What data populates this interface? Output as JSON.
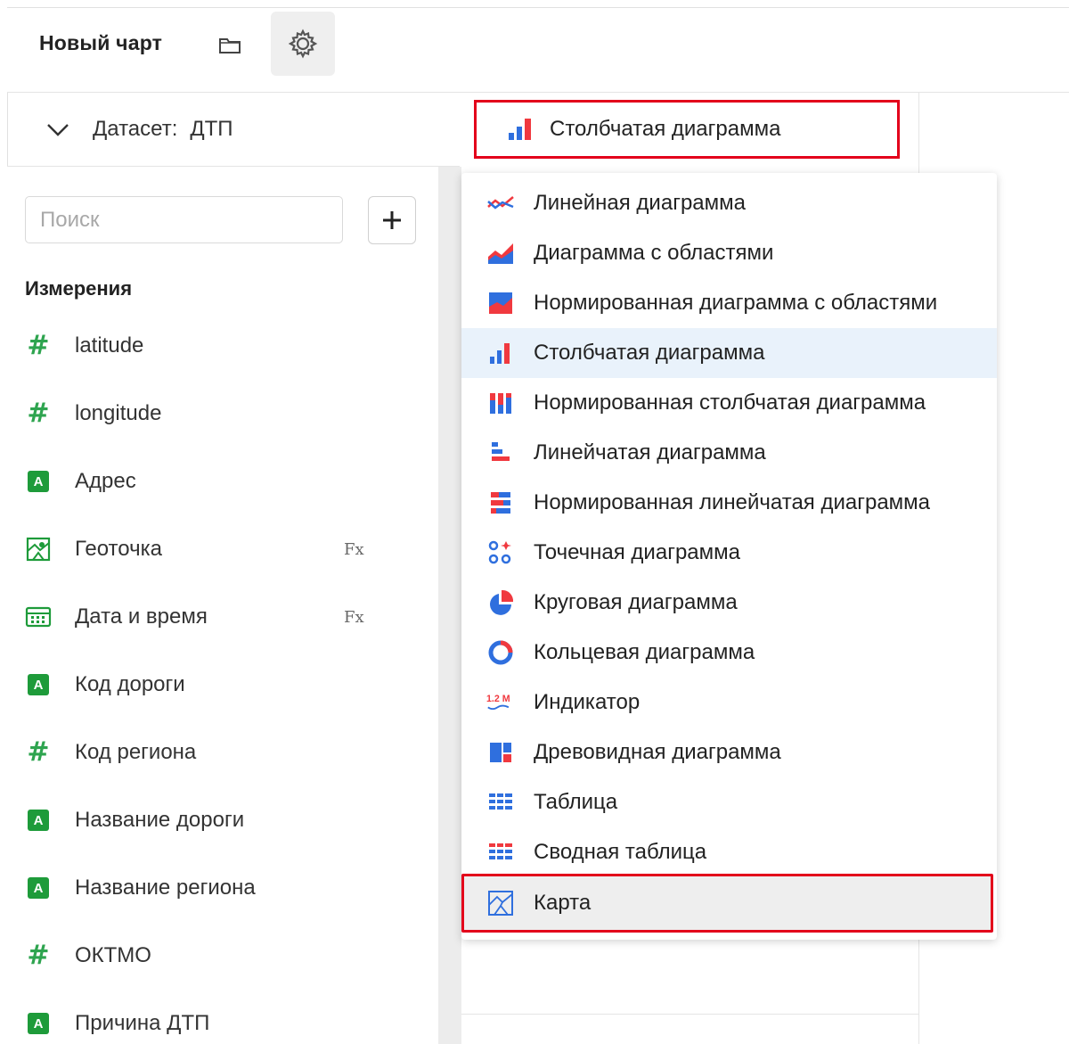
{
  "header": {
    "title": "Новый чарт"
  },
  "dataset": {
    "label": "Датасет:",
    "name": "ДТП"
  },
  "search": {
    "placeholder": "Поиск"
  },
  "dimensions": {
    "title": "Измерения",
    "fields": [
      {
        "name": "latitude",
        "type": "number",
        "fx": false
      },
      {
        "name": "longitude",
        "type": "number",
        "fx": false
      },
      {
        "name": "Адрес",
        "type": "string",
        "fx": false
      },
      {
        "name": "Геоточка",
        "type": "geopoint",
        "fx": true
      },
      {
        "name": "Дата и время",
        "type": "datetime",
        "fx": true
      },
      {
        "name": "Код дороги",
        "type": "string",
        "fx": false
      },
      {
        "name": "Код региона",
        "type": "number",
        "fx": false
      },
      {
        "name": "Название дороги",
        "type": "string",
        "fx": false
      },
      {
        "name": "Название региона",
        "type": "string",
        "fx": false
      },
      {
        "name": "ОКТМО",
        "type": "number",
        "fx": false
      },
      {
        "name": "Причина ДТП",
        "type": "string",
        "fx": false
      }
    ],
    "fx_label": "Fx",
    "string_badge": "A"
  },
  "chart_type": {
    "current": "Столбчатая диаграмма"
  },
  "chart_types": [
    {
      "label": "Линейная диаграмма",
      "icon": "line-chart-icon"
    },
    {
      "label": "Диаграмма с областями",
      "icon": "area-chart-icon"
    },
    {
      "label": "Нормированная диаграмма с областями",
      "icon": "normalized-area-chart-icon"
    },
    {
      "label": "Столбчатая диаграмма",
      "icon": "column-chart-icon",
      "selected": true
    },
    {
      "label": "Нормированная столбчатая диаграмма",
      "icon": "normalized-column-chart-icon"
    },
    {
      "label": "Линейчатая диаграмма",
      "icon": "bar-chart-icon"
    },
    {
      "label": "Нормированная линейчатая диаграмма",
      "icon": "normalized-bar-chart-icon"
    },
    {
      "label": "Точечная диаграмма",
      "icon": "scatter-chart-icon"
    },
    {
      "label": "Круговая диаграмма",
      "icon": "pie-chart-icon"
    },
    {
      "label": "Кольцевая диаграмма",
      "icon": "donut-chart-icon"
    },
    {
      "label": "Индикатор",
      "icon": "indicator-icon",
      "icon_text": "1.2 M"
    },
    {
      "label": "Древовидная диаграмма",
      "icon": "treemap-icon"
    },
    {
      "label": "Таблица",
      "icon": "table-icon"
    },
    {
      "label": "Сводная таблица",
      "icon": "pivot-table-icon"
    },
    {
      "label": "Карта",
      "icon": "map-icon",
      "highlighted": true
    }
  ],
  "colors": {
    "blue": "#2f6fde",
    "red": "#f0393f",
    "green": "#2ea44f",
    "highlight": "#e3001b",
    "selected_bg": "#e9f2fb"
  }
}
